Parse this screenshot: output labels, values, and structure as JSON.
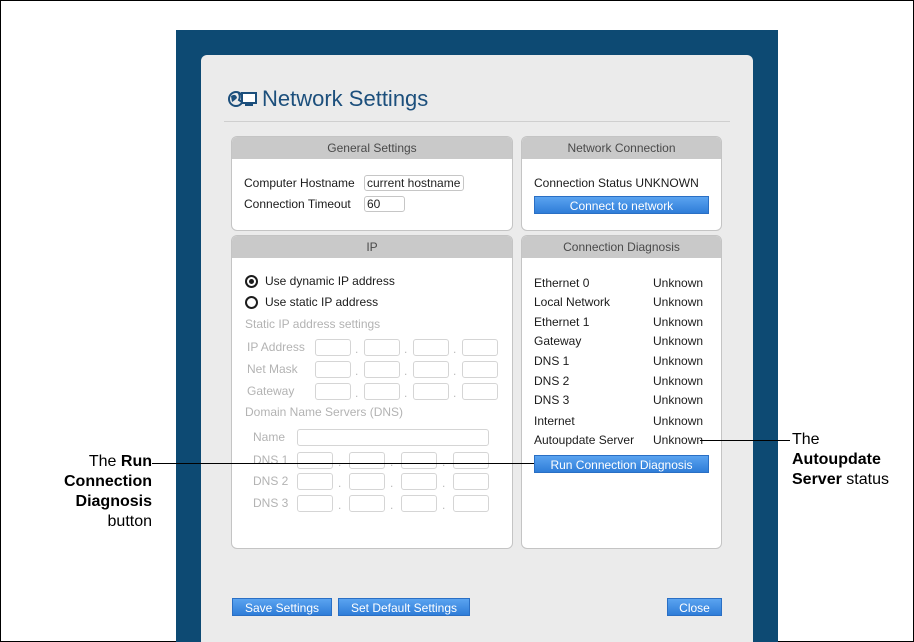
{
  "dialog": {
    "title": "Network Settings",
    "general": {
      "header": "General Settings",
      "hostname_label": "Computer Hostname",
      "hostname_value": "current hostname",
      "timeout_label": "Connection Timeout",
      "timeout_value": "60"
    },
    "network": {
      "header": "Network Connection",
      "status_label": "Connection Status",
      "status_value": "UNKNOWN",
      "connect_button": "Connect to network"
    },
    "ip": {
      "header": "IP",
      "dynamic_label": "Use dynamic IP address",
      "static_label": "Use static IP address",
      "static_settings_label": "Static IP address settings",
      "ip_address_label": "IP Address",
      "net_mask_label": "Net Mask",
      "gateway_label": "Gateway",
      "dns_label": "Domain Name Servers (DNS)",
      "name_label": "Name",
      "dns1_label": "DNS 1",
      "dns2_label": "DNS 2",
      "dns3_label": "DNS 3",
      "selected": "dynamic"
    },
    "diagnosis": {
      "header": "Connection Diagnosis",
      "rows": [
        {
          "name": "Ethernet 0",
          "status": "Unknown"
        },
        {
          "name": "Local Network",
          "status": "Unknown"
        },
        {
          "name": "Ethernet 1",
          "status": "Unknown"
        },
        {
          "name": "Gateway",
          "status": "Unknown"
        },
        {
          "name": "DNS 1",
          "status": "Unknown"
        },
        {
          "name": "DNS 2",
          "status": "Unknown"
        },
        {
          "name": "DNS 3",
          "status": "Unknown"
        },
        {
          "name": "Internet",
          "status": "Unknown"
        },
        {
          "name": "Autoupdate Server",
          "status": "Unknown"
        }
      ],
      "run_button": "Run Connection Diagnosis"
    },
    "footer": {
      "save": "Save Settings",
      "set_default": "Set Default Settings",
      "close": "Close"
    }
  },
  "callouts": {
    "left": {
      "pre": "The",
      "bold1": "Run",
      "bold2": "Connection",
      "bold3": "Diagnosis",
      "post": "button"
    },
    "right": {
      "pre": "The",
      "bold1": "Autoupdate",
      "bold2": "Server",
      "post": "status"
    }
  },
  "colors": {
    "outer": "#0d4a73",
    "button": "#2f7dd8",
    "title": "#1c4f7c"
  }
}
